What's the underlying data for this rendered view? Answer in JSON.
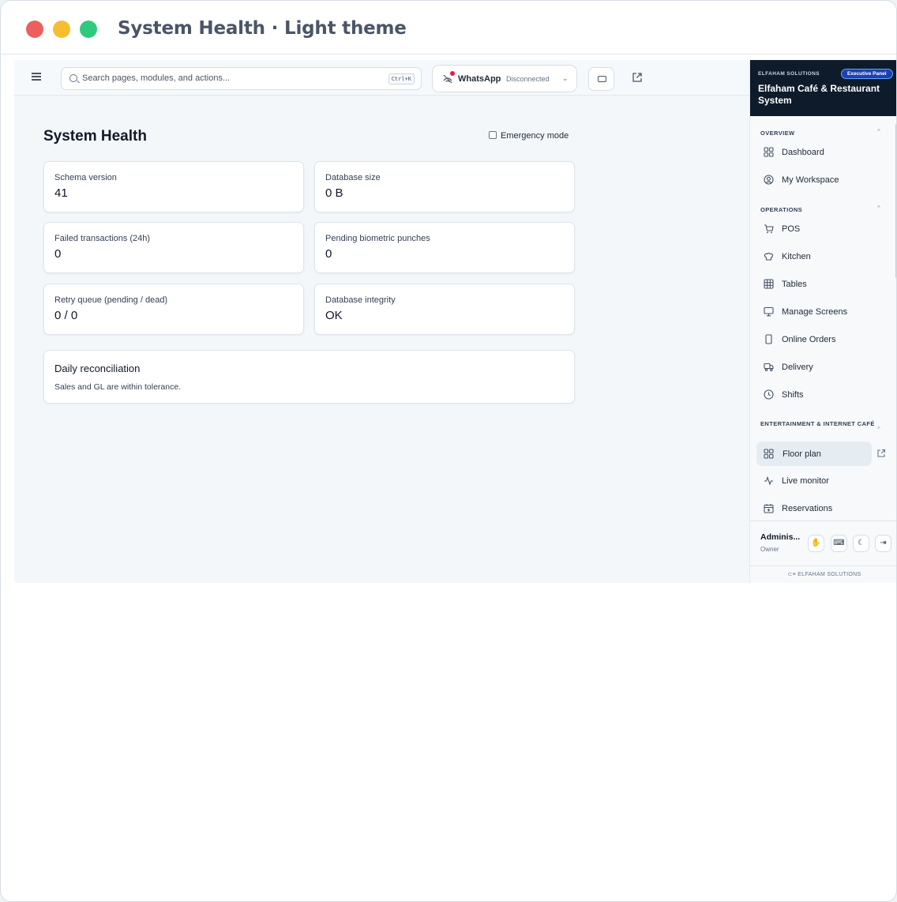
{
  "window": {
    "title": "System Health · Light theme",
    "traffic_colors": [
      "#ec5f5f",
      "#f5bd2f",
      "#2fcb7c"
    ]
  },
  "topbar": {
    "search_placeholder": "Search pages, modules, and actions...",
    "search_shortcut": "Ctrl+K",
    "whatsapp_label": "WhatsApp",
    "whatsapp_status": "Disconnected"
  },
  "main": {
    "page_title": "System Health",
    "emergency_label": "Emergency mode",
    "metrics": [
      {
        "label": "Schema version",
        "value": "41"
      },
      {
        "label": "Database size",
        "value": "0 B"
      },
      {
        "label": "Failed transactions (24h)",
        "value": "0"
      },
      {
        "label": "Pending biometric punches",
        "value": "0"
      },
      {
        "label": "Retry queue (pending / dead)",
        "value": "0 / 0"
      },
      {
        "label": "Database integrity",
        "value": "OK"
      }
    ],
    "reconciliation": {
      "title": "Daily reconciliation",
      "message": "Sales and GL are within tolerance."
    }
  },
  "sidebar": {
    "brand": "ELFAHAM SOLUTIONS",
    "badge": "Executive Panel",
    "system_name": "Elfaham Café & Restaurant System",
    "sections": [
      {
        "title": "OVERVIEW",
        "items": [
          {
            "label": "Dashboard",
            "icon": "grid-icon"
          },
          {
            "label": "My Workspace",
            "icon": "user-circle-icon"
          }
        ]
      },
      {
        "title": "OPERATIONS",
        "items": [
          {
            "label": "POS",
            "icon": "cart-icon"
          },
          {
            "label": "Kitchen",
            "icon": "chef-hat-icon"
          },
          {
            "label": "Tables",
            "icon": "table-icon"
          },
          {
            "label": "Manage Screens",
            "icon": "monitor-icon"
          },
          {
            "label": "Online Orders",
            "icon": "phone-icon"
          },
          {
            "label": "Delivery",
            "icon": "truck-icon"
          },
          {
            "label": "Shifts",
            "icon": "clock-icon"
          }
        ]
      },
      {
        "title": "ENTERTAINMENT & INTERNET CAFÉ",
        "items": [
          {
            "label": "Floor plan",
            "icon": "grid-icon"
          },
          {
            "label": "Live monitor",
            "icon": "activity-icon"
          },
          {
            "label": "Reservations",
            "icon": "calendar-icon"
          }
        ]
      }
    ],
    "user_name": "Adminis...",
    "user_role": "Owner",
    "footer_brand": "ELFAHAM SOLUTIONS"
  },
  "colors": {
    "sidebar_header": "#0d1b2a",
    "badge": "#1e40af",
    "whatsapp_alert": "#e11d48"
  }
}
